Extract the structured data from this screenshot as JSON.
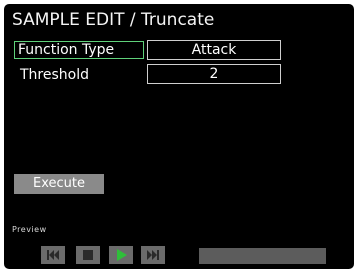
{
  "header": {
    "title": "SAMPLE EDIT / Truncate"
  },
  "params": [
    {
      "label": "Function Type",
      "value": "Attack",
      "selected": true
    },
    {
      "label": "Threshold",
      "value": "2",
      "selected": false
    }
  ],
  "actions": {
    "execute_label": "Execute"
  },
  "preview": {
    "label": "Preview",
    "controls": [
      "rewind-icon",
      "stop-icon",
      "play-icon",
      "fast-forward-icon"
    ],
    "progress": 0
  },
  "colors": {
    "background": "#000000",
    "selection_border": "#5fd17a",
    "button_gray": "#8a8a8a",
    "play_green": "#2fbf3a"
  }
}
